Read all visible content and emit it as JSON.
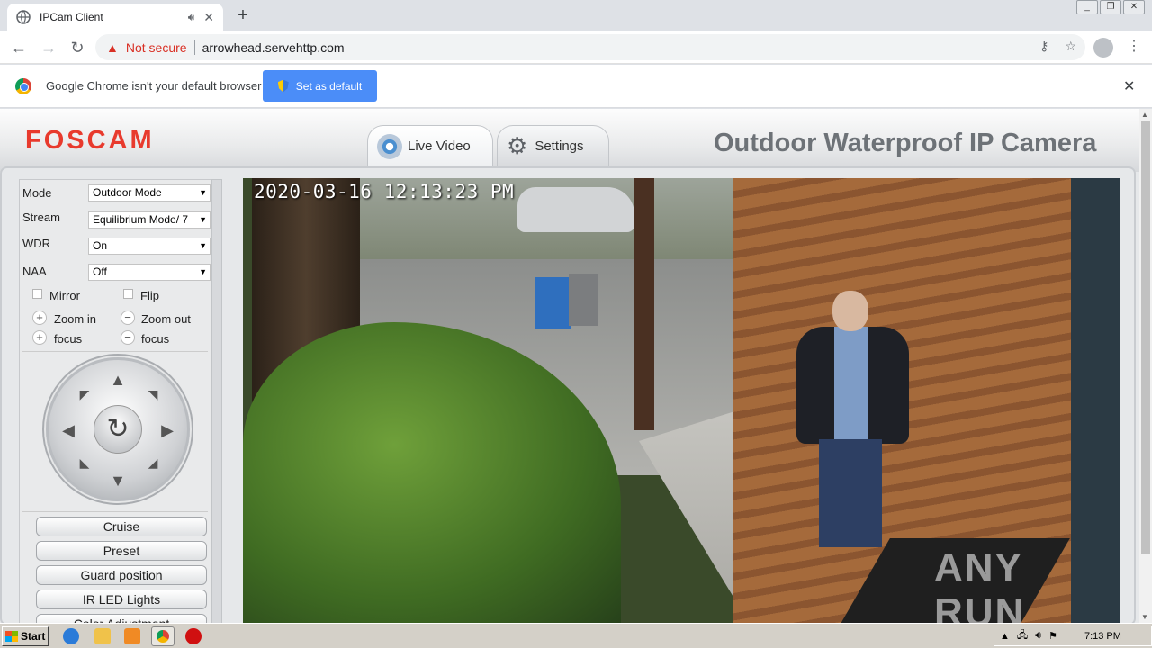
{
  "browser": {
    "tab_title": "IPCam Client",
    "new_tab_symbol": "+",
    "security_label": "Not secure",
    "url": "arrowhead.servehttp.com",
    "infobar_text": "Google Chrome isn't your default browser",
    "set_default_label": "Set as default"
  },
  "page": {
    "logo": "FOSCAM",
    "camera_title": "Outdoor Waterproof IP Camera",
    "tabs": [
      {
        "label": "Live Video"
      },
      {
        "label": "Settings"
      }
    ]
  },
  "controls": {
    "mode": {
      "label": "Mode",
      "value": "Outdoor Mode"
    },
    "stream": {
      "label": "Stream",
      "value": "Equilibrium Mode/ 7"
    },
    "wdr": {
      "label": "WDR",
      "value": "On"
    },
    "naa": {
      "label": "NAA",
      "value": "Off"
    },
    "mirror_label": "Mirror",
    "flip_label": "Flip",
    "zoom_in_label": "Zoom in",
    "zoom_out_label": "Zoom out",
    "focus_in_label": "focus",
    "focus_out_label": "focus",
    "buttons": [
      "Cruise",
      "Preset",
      "Guard position",
      "IR LED Lights",
      "Color Adjustment"
    ]
  },
  "video": {
    "timestamp": "2020-03-16 12:13:23 PM",
    "watermark": "ANY RUN"
  },
  "taskbar": {
    "start_label": "Start",
    "clock": "7:13 PM"
  }
}
